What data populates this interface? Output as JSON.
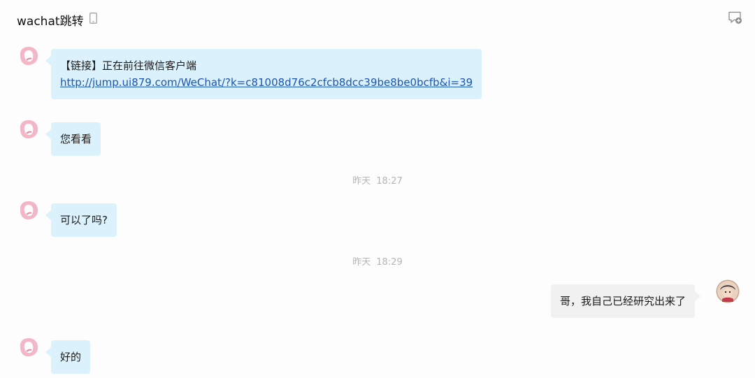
{
  "header": {
    "title": "wachat跳转",
    "device_icon": "phone-icon",
    "action_icon": "add-chat-icon"
  },
  "messages": [
    {
      "side": "incoming",
      "line1": "【链接】正在前往微信客户端",
      "link": "http://jump.ui879.com/WeChat/?k=c81008d76c2cfcb8dcc39be8be0bcfb&i=39"
    },
    {
      "side": "incoming",
      "text": "您看看"
    },
    {
      "side": "incoming",
      "text": "可以了吗?"
    },
    {
      "side": "outgoing",
      "text": "哥，我自己已经研究出来了"
    },
    {
      "side": "incoming",
      "text": "好的"
    }
  ],
  "timestamps": [
    {
      "day": "昨天",
      "time": "18:27"
    },
    {
      "day": "昨天",
      "time": "18:29"
    }
  ],
  "colors": {
    "incoming_bubble": "#dbf2fc",
    "outgoing_bubble": "#f1f1f1",
    "link": "#1a55b6",
    "timestamp": "#b5b5b5"
  }
}
